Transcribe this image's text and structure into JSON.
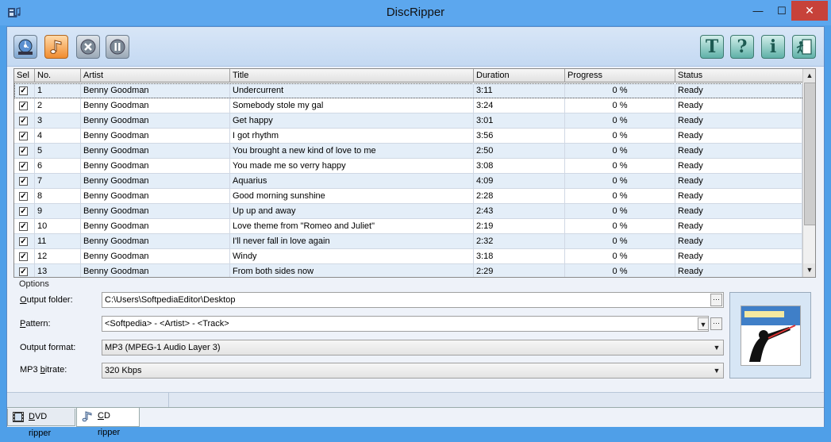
{
  "window": {
    "title": "DiscRipper",
    "min_glyph": "—",
    "max_glyph": "☐",
    "close_glyph": "✕"
  },
  "toolbar": {
    "tools_letter": "T",
    "help_letter": "?",
    "info_letter": "i"
  },
  "columns": [
    "Sel",
    "No.",
    "Artist",
    "Title",
    "Duration",
    "Progress",
    "Status"
  ],
  "tracks": [
    {
      "no": "1",
      "artist": "Benny Goodman",
      "title": "Undercurrent",
      "duration": "3:11",
      "progress": "0 %",
      "status": "Ready",
      "checked": true
    },
    {
      "no": "2",
      "artist": "Benny Goodman",
      "title": "Somebody stole my gal",
      "duration": "3:24",
      "progress": "0 %",
      "status": "Ready",
      "checked": true
    },
    {
      "no": "3",
      "artist": "Benny Goodman",
      "title": "Get happy",
      "duration": "3:01",
      "progress": "0 %",
      "status": "Ready",
      "checked": true
    },
    {
      "no": "4",
      "artist": "Benny Goodman",
      "title": "I got rhythm",
      "duration": "3:56",
      "progress": "0 %",
      "status": "Ready",
      "checked": true
    },
    {
      "no": "5",
      "artist": "Benny Goodman",
      "title": "You brought a new kind of love to me",
      "duration": "2:50",
      "progress": "0 %",
      "status": "Ready",
      "checked": true
    },
    {
      "no": "6",
      "artist": "Benny Goodman",
      "title": "You made me so verry happy",
      "duration": "3:08",
      "progress": "0 %",
      "status": "Ready",
      "checked": true
    },
    {
      "no": "7",
      "artist": "Benny Goodman",
      "title": "Aquarius",
      "duration": "4:09",
      "progress": "0 %",
      "status": "Ready",
      "checked": true
    },
    {
      "no": "8",
      "artist": "Benny Goodman",
      "title": "Good morning sunshine",
      "duration": "2:28",
      "progress": "0 %",
      "status": "Ready",
      "checked": true
    },
    {
      "no": "9",
      "artist": "Benny Goodman",
      "title": "Up up and away",
      "duration": "2:43",
      "progress": "0 %",
      "status": "Ready",
      "checked": true
    },
    {
      "no": "10",
      "artist": "Benny Goodman",
      "title": "Love theme from \"Romeo and Juliet\"",
      "duration": "2:19",
      "progress": "0 %",
      "status": "Ready",
      "checked": true
    },
    {
      "no": "11",
      "artist": "Benny Goodman",
      "title": "I'll never fall in love again",
      "duration": "2:32",
      "progress": "0 %",
      "status": "Ready",
      "checked": true
    },
    {
      "no": "12",
      "artist": "Benny Goodman",
      "title": "Windy",
      "duration": "3:18",
      "progress": "0 %",
      "status": "Ready",
      "checked": true
    },
    {
      "no": "13",
      "artist": "Benny Goodman",
      "title": "From both sides now",
      "duration": "2:29",
      "progress": "0 %",
      "status": "Ready",
      "checked": true
    }
  ],
  "options": {
    "group_label": "Options",
    "output_folder": {
      "label_pre": "",
      "label_u": "O",
      "label_post": "utput folder:",
      "value": "C:\\Users\\SoftpediaEditor\\Desktop"
    },
    "pattern": {
      "label_u": "P",
      "label_post": "attern:",
      "value": "<Softpedia> - <Artist> - <Track>"
    },
    "output_format": {
      "label": "Output format:",
      "value": "MP3 (MPEG-1 Audio Layer 3)"
    },
    "bitrate": {
      "label_pre": "MP3 ",
      "label_u": "b",
      "label_post": "itrate:",
      "value": "320 Kbps"
    }
  },
  "tabs": {
    "dvd": {
      "label_u": "D",
      "label_post": "VD ripper"
    },
    "cd": {
      "label_u": "C",
      "label_post": "D ripper"
    }
  },
  "glyphs": {
    "ellipsis": "···",
    "down": "▼",
    "up": "▲",
    "check": "✓"
  },
  "colors": {
    "titlebar": "#5ca7ee",
    "close": "#c7423a",
    "alt_row": "#e4eef8",
    "tool_right": "#5fb1a8",
    "music_button": "#f08c30"
  }
}
